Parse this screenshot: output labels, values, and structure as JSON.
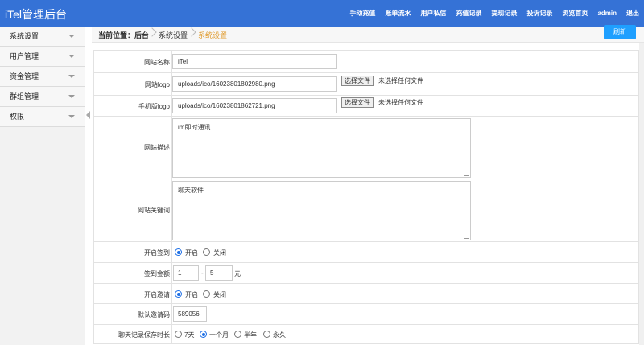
{
  "header": {
    "brand": "iTel管理后台",
    "nav": [
      "手动充值",
      "账单流水",
      "用户私信",
      "充值记录",
      "提现记录",
      "投诉记录",
      "浏览首页",
      "admin",
      "退出"
    ]
  },
  "sidebar": {
    "items": [
      {
        "label": "系统设置"
      },
      {
        "label": "用户管理"
      },
      {
        "label": "资金管理"
      },
      {
        "label": "群组管理"
      },
      {
        "label": "权限"
      }
    ]
  },
  "breadcrumb": {
    "prefix": "当前位置：后台",
    "level1": "系统设置",
    "current": "系统设置"
  },
  "toolbar": {
    "refresh_label": "刷新"
  },
  "form": {
    "site_name": {
      "label": "网站名称",
      "value": "iTel"
    },
    "site_logo": {
      "label": "网站logo",
      "value": "uploads/ico/16023801802980.png",
      "choose_btn": "选择文件",
      "no_file": "未选择任何文件"
    },
    "mobile_logo": {
      "label": "手机版logo",
      "value": "uploads/ico/16023801862721.png",
      "choose_btn": "选择文件",
      "no_file": "未选择任何文件"
    },
    "site_desc": {
      "label": "网站描述",
      "value": "im即时通讯"
    },
    "site_keywords": {
      "label": "网站关键词",
      "value": "聊天软件"
    },
    "signin": {
      "label": "开启签到",
      "options": [
        "开启",
        "关闭"
      ],
      "selected": "开启"
    },
    "signin_amount": {
      "label": "签到金额",
      "min": "1",
      "dash": "-",
      "max": "5",
      "unit": "元"
    },
    "invite": {
      "label": "开启邀请",
      "options": [
        "开启",
        "关闭"
      ],
      "selected": "开启"
    },
    "default_invite": {
      "label": "默认邀请码",
      "value": "589056"
    },
    "chat_retention": {
      "label": "聊天记录保存时长",
      "options": [
        "7天",
        "一个月",
        "半年",
        "永久"
      ],
      "selected": "一个月"
    }
  }
}
